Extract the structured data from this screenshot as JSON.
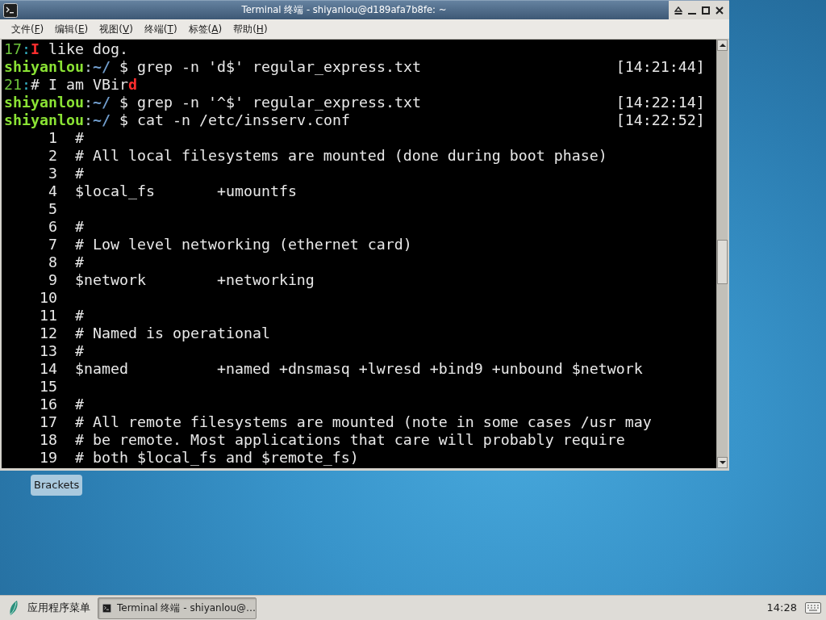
{
  "window": {
    "title": "Terminal 终端 - shiyanlou@d189afa7b8fe: ~"
  },
  "menu_bar": [
    {
      "before": "文件(",
      "key": "F",
      "after": ")"
    },
    {
      "before": "编辑(",
      "key": "E",
      "after": ")"
    },
    {
      "before": "视图(",
      "key": "V",
      "after": ")"
    },
    {
      "before": "终端(",
      "key": "T",
      "after": ")"
    },
    {
      "before": "标签(",
      "key": "A",
      "after": ")"
    },
    {
      "before": "帮助(",
      "key": "H",
      "after": ")"
    }
  ],
  "terminal": {
    "lines": [
      {
        "kind": "output",
        "segments": [
          {
            "kind": "lineno",
            "text": "17"
          },
          {
            "kind": "sep",
            "text": ":"
          },
          {
            "kind": "match",
            "text": "I"
          },
          {
            "kind": "plain",
            "text": " like dog."
          }
        ]
      },
      {
        "kind": "prompt",
        "segments": [
          {
            "kind": "user",
            "text": "shiyanlou"
          },
          {
            "kind": "colon",
            "text": ":"
          },
          {
            "kind": "path",
            "text": "~/"
          },
          {
            "kind": "plain",
            "text": " $ grep -n 'd$' regular_express.txt"
          }
        ],
        "time": "[14:21:44]"
      },
      {
        "kind": "output",
        "segments": [
          {
            "kind": "lineno",
            "text": "21"
          },
          {
            "kind": "sep",
            "text": ":"
          },
          {
            "kind": "plain",
            "text": "# I am VBir"
          },
          {
            "kind": "match",
            "text": "d"
          }
        ]
      },
      {
        "kind": "prompt",
        "segments": [
          {
            "kind": "user",
            "text": "shiyanlou"
          },
          {
            "kind": "colon",
            "text": ":"
          },
          {
            "kind": "path",
            "text": "~/"
          },
          {
            "kind": "plain",
            "text": " $ grep -n '^$' regular_express.txt"
          }
        ],
        "time": "[14:22:14]"
      },
      {
        "kind": "prompt",
        "segments": [
          {
            "kind": "user",
            "text": "shiyanlou"
          },
          {
            "kind": "colon",
            "text": ":"
          },
          {
            "kind": "path",
            "text": "~/"
          },
          {
            "kind": "plain",
            "text": " $ cat -n /etc/insserv.conf"
          }
        ],
        "time": "[14:22:52]"
      },
      {
        "kind": "numbered",
        "number": "1",
        "text": "#"
      },
      {
        "kind": "numbered",
        "number": "2",
        "text": "# All local filesystems are mounted (done during boot phase)"
      },
      {
        "kind": "numbered",
        "number": "3",
        "text": "#"
      },
      {
        "kind": "numbered",
        "number": "4",
        "text": "$local_fs       +umountfs"
      },
      {
        "kind": "numbered",
        "number": "5"
      },
      {
        "kind": "numbered",
        "number": "6",
        "text": "#"
      },
      {
        "kind": "numbered",
        "number": "7",
        "text": "# Low level networking (ethernet card)"
      },
      {
        "kind": "numbered",
        "number": "8",
        "text": "#"
      },
      {
        "kind": "numbered",
        "number": "9",
        "text": "$network        +networking"
      },
      {
        "kind": "numbered",
        "number": "10"
      },
      {
        "kind": "numbered",
        "number": "11",
        "text": "#"
      },
      {
        "kind": "numbered",
        "number": "12",
        "text": "# Named is operational"
      },
      {
        "kind": "numbered",
        "number": "13",
        "text": "#"
      },
      {
        "kind": "numbered",
        "number": "14",
        "text": "$named          +named +dnsmasq +lwresd +bind9 +unbound $network"
      },
      {
        "kind": "numbered",
        "number": "15"
      },
      {
        "kind": "numbered",
        "number": "16",
        "text": "#"
      },
      {
        "kind": "numbered",
        "number": "17",
        "text": "# All remote filesystems are mounted (note in some cases /usr may"
      },
      {
        "kind": "numbered",
        "number": "18",
        "text": "# be remote. Most applications that care will probably require"
      },
      {
        "kind": "numbered",
        "number": "19",
        "text": "# both $local_fs and $remote_fs)"
      }
    ]
  },
  "desktop": {
    "icons": [
      {
        "label": "Brackets"
      }
    ]
  },
  "taskbar": {
    "app_menu": "应用程序菜单",
    "tasks": [
      {
        "label": "Terminal 终端 - shiyanlou@…",
        "selected": true
      }
    ],
    "clock": "14:28"
  }
}
